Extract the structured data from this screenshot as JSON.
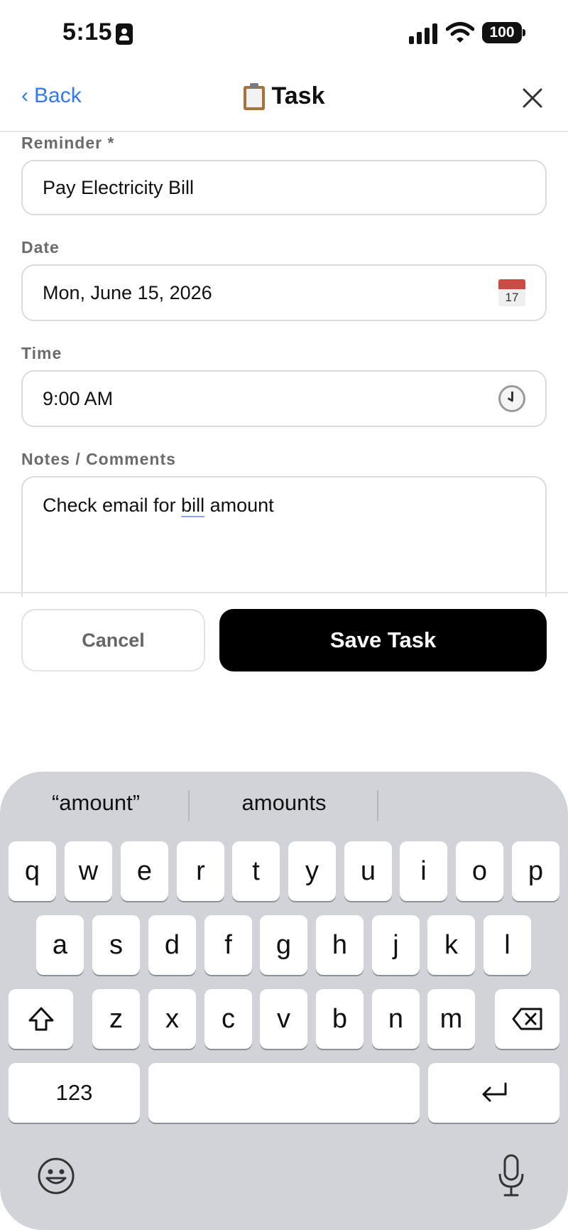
{
  "status_bar": {
    "time": "5:15",
    "battery": "100"
  },
  "nav": {
    "back_label": "Back",
    "back_chevron": "‹",
    "title": "Task",
    "title_icon": "clipboard-icon"
  },
  "form": {
    "reminder": {
      "label": "Reminder *",
      "value": "Pay Electricity Bill"
    },
    "date": {
      "label": "Date",
      "value": "Mon, June 15, 2026",
      "icon_day": "17"
    },
    "time": {
      "label": "Time",
      "value": "9:00 AM"
    },
    "notes": {
      "label": "Notes / Comments",
      "value_before": "Check email for ",
      "value_underlined": "bill",
      "value_after": " amount"
    }
  },
  "actions": {
    "cancel_label": "Cancel",
    "save_label": "Save Task"
  },
  "keyboard": {
    "suggestions": [
      "“amount”",
      "amounts",
      ""
    ],
    "row1": [
      "q",
      "w",
      "e",
      "r",
      "t",
      "y",
      "u",
      "i",
      "o",
      "p"
    ],
    "row2": [
      "a",
      "s",
      "d",
      "f",
      "g",
      "h",
      "j",
      "k",
      "l"
    ],
    "row3": [
      "z",
      "x",
      "c",
      "v",
      "b",
      "n",
      "m"
    ],
    "numbers_label": "123",
    "colors": {
      "background": "#d1d3d9",
      "key": "#ffffff"
    }
  },
  "colors": {
    "accent": "#2f7bf5",
    "save_button": "#000000"
  }
}
